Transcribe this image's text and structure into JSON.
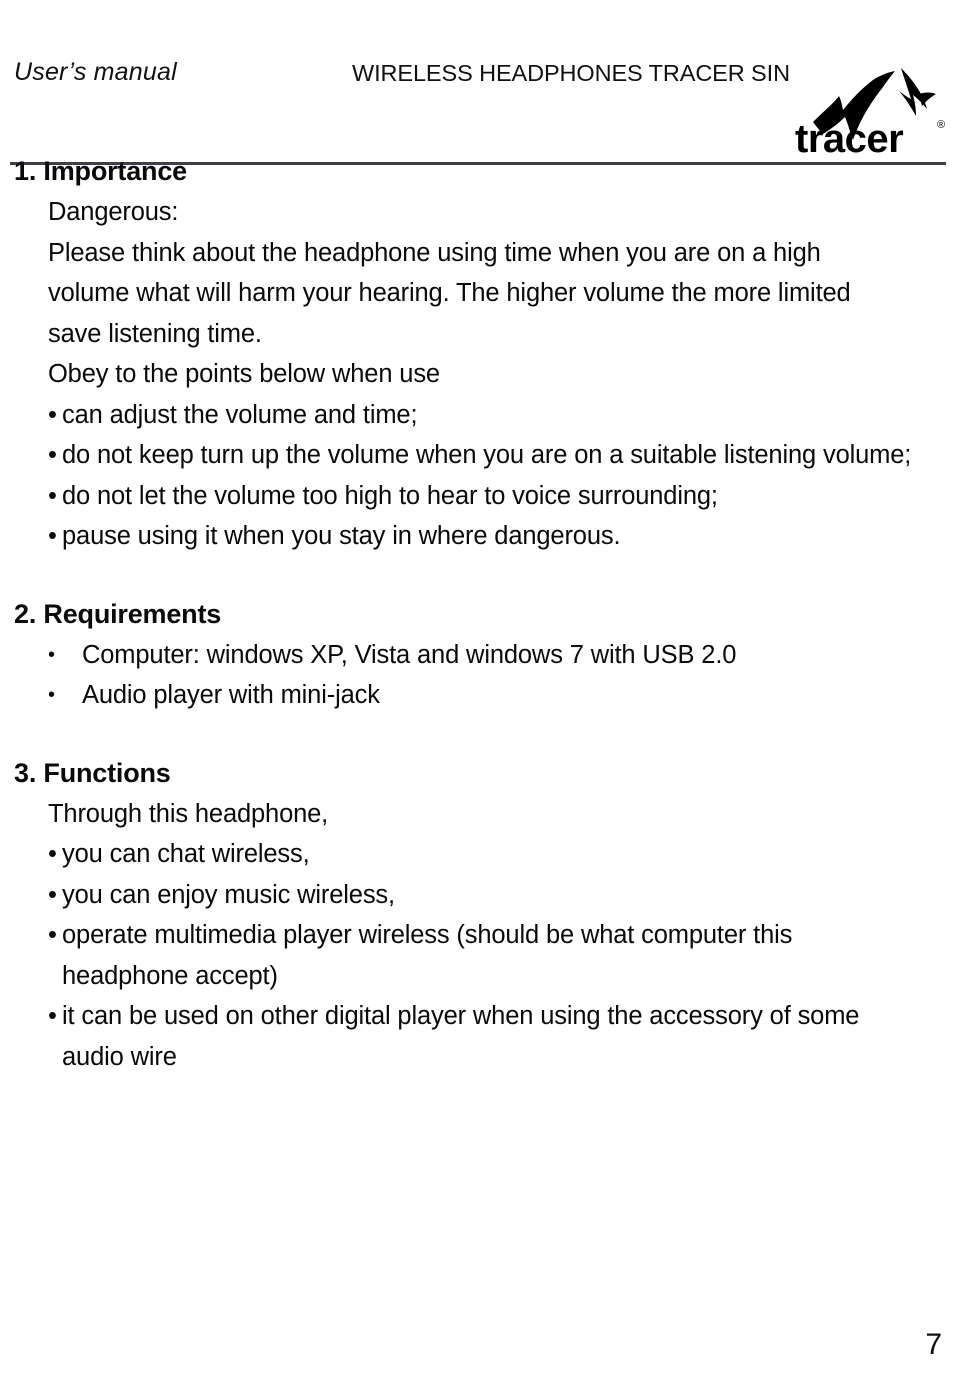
{
  "header": {
    "left_label": "User’s manual",
    "center_title": "WIRELESS HEADPHONES TRACER SIN",
    "logo_wordmark": "tracer",
    "logo_trademark": "®"
  },
  "sections": [
    {
      "heading": "1. Importance",
      "subheading": "Dangerous:",
      "paragraph": "Please think about the headphone using time when you are on a high volume what will harm your hearing. The higher volume the more limited save listening time.",
      "lead_in": "Obey to the points below when use",
      "bullets": [
        "can adjust the volume and time;",
        "do not keep turn up the volume when you are on a suitable listening volume;",
        "do not let the volume too high to hear to voice surrounding;",
        "pause using it when you stay in where dangerous."
      ]
    },
    {
      "heading": "2. Requirements",
      "bullets": [
        "Computer: windows XP, Vista and windows 7 with USB 2.0",
        "Audio player with mini-jack"
      ]
    },
    {
      "heading": "3. Functions",
      "lead_in": "Through this headphone,",
      "bullets": [
        "you can chat wireless,",
        "you can enjoy music wireless,",
        "operate multimedia player wireless (should be what computer this headphone accept)",
        "it can be used on other digital player when using the accessory of some audio wire"
      ]
    }
  ],
  "bullet_glyph": "•",
  "footer": {
    "page_number": "7"
  },
  "colors": {
    "text": "#0a0a0a",
    "rule": "#3d4147",
    "background": "#ffffff"
  }
}
